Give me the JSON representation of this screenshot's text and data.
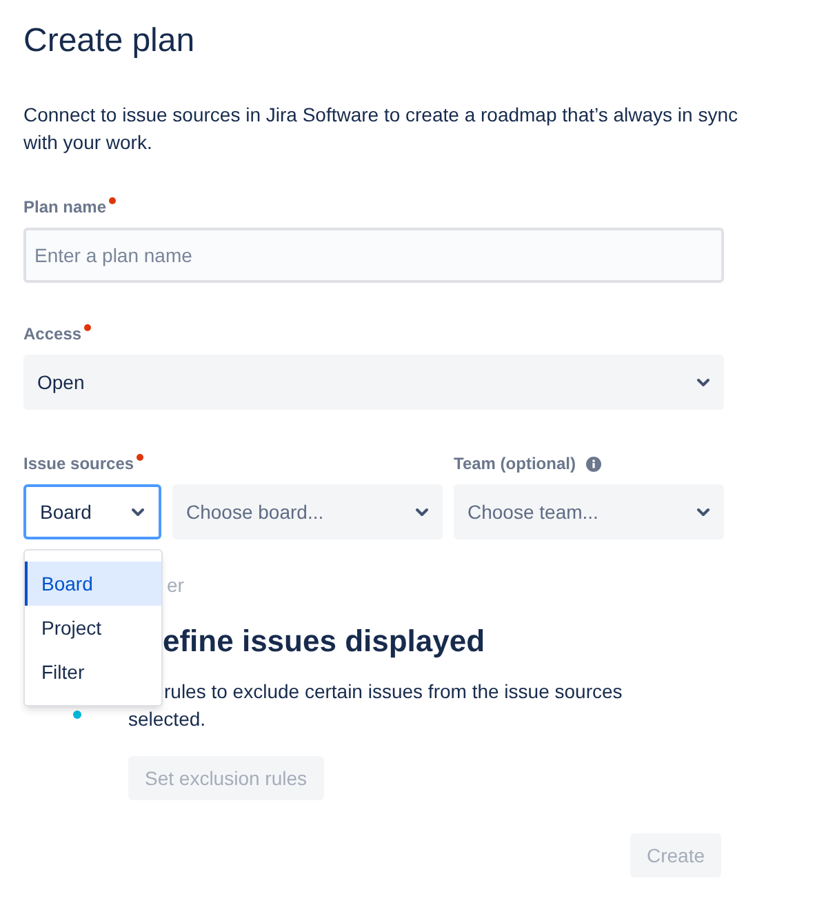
{
  "title": "Create plan",
  "intro": "Connect to issue sources in Jira Software to create a roadmap that’s always in sync with your work.",
  "plan_name": {
    "label": "Plan name",
    "required": true,
    "placeholder": "Enter a plan name"
  },
  "access": {
    "label": "Access",
    "required": true,
    "value": "Open"
  },
  "issue_sources": {
    "label": "Issue sources",
    "required": true,
    "type_value": "Board",
    "focused": true,
    "board_placeholder": "Choose board..."
  },
  "team": {
    "label": "Team (optional)",
    "placeholder": "Choose team..."
  },
  "partial_link": "er",
  "define": {
    "heading": "efine issues displayed",
    "text": "rules to exclude certain issues from the issue sources selected.",
    "button": "Set exclusion rules",
    "button_disabled": true
  },
  "create_button": {
    "label": "Create",
    "disabled": true
  },
  "menu": [
    {
      "label": "Board",
      "selected": true
    },
    {
      "label": "Project",
      "selected": false
    },
    {
      "label": "Filter",
      "selected": false
    }
  ]
}
